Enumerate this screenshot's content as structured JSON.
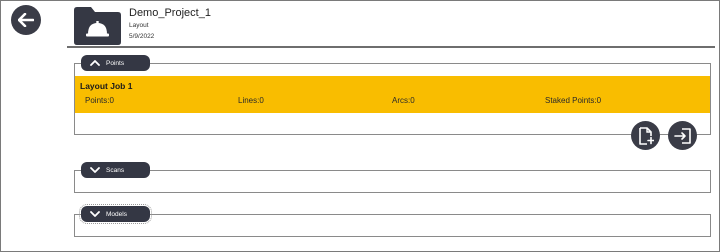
{
  "header": {
    "project_name": "Demo_Project_1",
    "project_type": "Layout",
    "project_date": "5/9/2022"
  },
  "icons": {
    "back": "arrow-left-icon",
    "folder": "folder-hardhat-icon",
    "new_file": "file-add-icon",
    "import": "import-icon",
    "chevron_up": "chevron-up-icon",
    "chevron_down": "chevron-down-icon"
  },
  "sections": {
    "points": {
      "label": "Points",
      "expanded": true
    },
    "scans": {
      "label": "Scans",
      "expanded": false
    },
    "models": {
      "label": "Models",
      "expanded": false
    }
  },
  "job": {
    "title": "Layout Job 1",
    "points": "Points:0",
    "lines": "Lines:0",
    "arcs": "Arcs:0",
    "staked": "Staked Points:0"
  },
  "colors": {
    "accent": "#f9bd00",
    "dark": "#343744",
    "border": "#8a8a8a"
  }
}
